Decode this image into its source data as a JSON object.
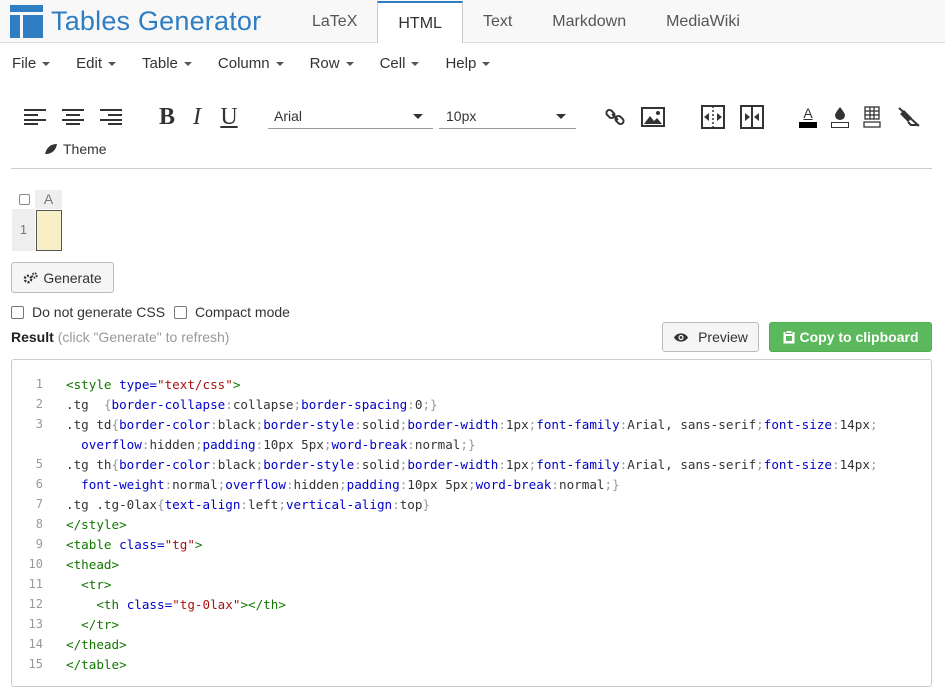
{
  "app": {
    "title": "Tables Generator"
  },
  "tabs": [
    {
      "label": "LaTeX",
      "active": false
    },
    {
      "label": "HTML",
      "active": true
    },
    {
      "label": "Text",
      "active": false
    },
    {
      "label": "Markdown",
      "active": false
    },
    {
      "label": "MediaWiki",
      "active": false
    }
  ],
  "menu": [
    "File",
    "Edit",
    "Table",
    "Column",
    "Row",
    "Cell",
    "Help"
  ],
  "toolbar": {
    "bold": "B",
    "italic": "I",
    "underline": "U",
    "font_family": "Arial",
    "font_size": "10px",
    "text_color_glyph": "A",
    "theme_label": "Theme"
  },
  "grid": {
    "col_label": "A",
    "row_label": "1"
  },
  "generate_label": "Generate",
  "options": {
    "no_css": "Do not generate CSS",
    "compact": "Compact mode"
  },
  "result": {
    "title": "Result",
    "hint": "(click \"Generate\" to refresh)"
  },
  "preview_label": "Preview",
  "copy_label": "Copy to clipboard",
  "code_lines": [
    {
      "n": "1",
      "parts": [
        [
          "tag",
          "<style "
        ],
        [
          "attr",
          "type="
        ],
        [
          "str",
          "\"text/css\""
        ],
        [
          "tag",
          ">"
        ]
      ]
    },
    {
      "n": "2",
      "parts": [
        [
          "sel",
          ".tg  "
        ],
        [
          "punc",
          "{"
        ],
        [
          "prop",
          "border-collapse"
        ],
        [
          "punc",
          ":"
        ],
        [
          "val",
          "collapse"
        ],
        [
          "punc",
          ";"
        ],
        [
          "prop",
          "border-spacing"
        ],
        [
          "punc",
          ":"
        ],
        [
          "val",
          "0"
        ],
        [
          "punc",
          ";}"
        ]
      ]
    },
    {
      "n": "3",
      "parts": [
        [
          "sel",
          ".tg td"
        ],
        [
          "punc",
          "{"
        ],
        [
          "prop",
          "border-color"
        ],
        [
          "punc",
          ":"
        ],
        [
          "val",
          "black"
        ],
        [
          "punc",
          ";"
        ],
        [
          "prop",
          "border-style"
        ],
        [
          "punc",
          ":"
        ],
        [
          "val",
          "solid"
        ],
        [
          "punc",
          ";"
        ],
        [
          "prop",
          "border-width"
        ],
        [
          "punc",
          ":"
        ],
        [
          "val",
          "1px"
        ],
        [
          "punc",
          ";"
        ],
        [
          "prop",
          "font-family"
        ],
        [
          "punc",
          ":"
        ],
        [
          "val",
          "Arial, sans-serif"
        ],
        [
          "punc",
          ";"
        ],
        [
          "prop",
          "font-size"
        ],
        [
          "punc",
          ":"
        ],
        [
          "val",
          "14px"
        ],
        [
          "punc",
          ";"
        ]
      ]
    },
    {
      "n": "",
      "parts": [
        [
          "val",
          "  "
        ],
        [
          "prop",
          "overflow"
        ],
        [
          "punc",
          ":"
        ],
        [
          "val",
          "hidden"
        ],
        [
          "punc",
          ";"
        ],
        [
          "prop",
          "padding"
        ],
        [
          "punc",
          ":"
        ],
        [
          "val",
          "10px 5px"
        ],
        [
          "punc",
          ";"
        ],
        [
          "prop",
          "word-break"
        ],
        [
          "punc",
          ":"
        ],
        [
          "val",
          "normal"
        ],
        [
          "punc",
          ";}"
        ]
      ]
    },
    {
      "n": "5",
      "parts": [
        [
          "sel",
          ".tg th"
        ],
        [
          "punc",
          "{"
        ],
        [
          "prop",
          "border-color"
        ],
        [
          "punc",
          ":"
        ],
        [
          "val",
          "black"
        ],
        [
          "punc",
          ";"
        ],
        [
          "prop",
          "border-style"
        ],
        [
          "punc",
          ":"
        ],
        [
          "val",
          "solid"
        ],
        [
          "punc",
          ";"
        ],
        [
          "prop",
          "border-width"
        ],
        [
          "punc",
          ":"
        ],
        [
          "val",
          "1px"
        ],
        [
          "punc",
          ";"
        ],
        [
          "prop",
          "font-family"
        ],
        [
          "punc",
          ":"
        ],
        [
          "val",
          "Arial, sans-serif"
        ],
        [
          "punc",
          ";"
        ],
        [
          "prop",
          "font-size"
        ],
        [
          "punc",
          ":"
        ],
        [
          "val",
          "14px"
        ],
        [
          "punc",
          ";"
        ]
      ]
    },
    {
      "n": "6",
      "parts": [
        [
          "val",
          "  "
        ],
        [
          "prop",
          "font-weight"
        ],
        [
          "punc",
          ":"
        ],
        [
          "val",
          "normal"
        ],
        [
          "punc",
          ";"
        ],
        [
          "prop",
          "overflow"
        ],
        [
          "punc",
          ":"
        ],
        [
          "val",
          "hidden"
        ],
        [
          "punc",
          ";"
        ],
        [
          "prop",
          "padding"
        ],
        [
          "punc",
          ":"
        ],
        [
          "val",
          "10px 5px"
        ],
        [
          "punc",
          ";"
        ],
        [
          "prop",
          "word-break"
        ],
        [
          "punc",
          ":"
        ],
        [
          "val",
          "normal"
        ],
        [
          "punc",
          ";}"
        ]
      ]
    },
    {
      "n": "7",
      "parts": [
        [
          "sel",
          ".tg .tg-0lax"
        ],
        [
          "punc",
          "{"
        ],
        [
          "prop",
          "text-align"
        ],
        [
          "punc",
          ":"
        ],
        [
          "val",
          "left"
        ],
        [
          "punc",
          ";"
        ],
        [
          "prop",
          "vertical-align"
        ],
        [
          "punc",
          ":"
        ],
        [
          "val",
          "top"
        ],
        [
          "punc",
          "}"
        ]
      ]
    },
    {
      "n": "8",
      "parts": [
        [
          "tag",
          "</style>"
        ]
      ]
    },
    {
      "n": "9",
      "parts": [
        [
          "tag",
          "<table "
        ],
        [
          "attr",
          "class="
        ],
        [
          "str",
          "\"tg\""
        ],
        [
          "tag",
          ">"
        ]
      ]
    },
    {
      "n": "10",
      "parts": [
        [
          "tag",
          "<thead>"
        ]
      ]
    },
    {
      "n": "11",
      "parts": [
        [
          "val",
          "  "
        ],
        [
          "tag",
          "<tr>"
        ]
      ]
    },
    {
      "n": "12",
      "parts": [
        [
          "val",
          "    "
        ],
        [
          "tag",
          "<th "
        ],
        [
          "attr",
          "class="
        ],
        [
          "str",
          "\"tg-0lax\""
        ],
        [
          "tag",
          "></th>"
        ]
      ]
    },
    {
      "n": "13",
      "parts": [
        [
          "val",
          "  "
        ],
        [
          "tag",
          "</tr>"
        ]
      ]
    },
    {
      "n": "14",
      "parts": [
        [
          "tag",
          "</thead>"
        ]
      ]
    },
    {
      "n": "15",
      "parts": [
        [
          "tag",
          "</table>"
        ]
      ]
    }
  ]
}
